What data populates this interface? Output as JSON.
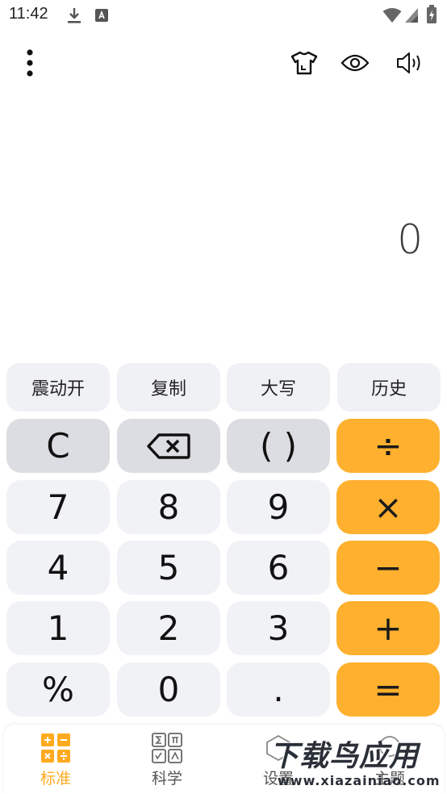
{
  "status_bar": {
    "time": "11:42"
  },
  "display": {
    "value": "0"
  },
  "function_row": [
    {
      "label": "震动开"
    },
    {
      "label": "复制"
    },
    {
      "label": "大写"
    },
    {
      "label": "历史"
    }
  ],
  "keypad": {
    "row1": [
      "C",
      "⌫",
      "( )",
      "÷"
    ],
    "row2": [
      "7",
      "8",
      "9",
      "×"
    ],
    "row3": [
      "4",
      "5",
      "6",
      "−"
    ],
    "row4": [
      "1",
      "2",
      "3",
      "+"
    ],
    "row5": [
      "%",
      "0",
      ".",
      "="
    ]
  },
  "tabs": [
    {
      "label": "标准",
      "active": true
    },
    {
      "label": "科学",
      "active": false
    },
    {
      "label": "设置",
      "active": false
    },
    {
      "label": "主题",
      "active": false
    }
  ],
  "watermark": {
    "title": "下载鸟应用",
    "url": "www.xiazainiao.com"
  },
  "colors": {
    "accent": "#ffb02e",
    "key_light": "#f1f2f6",
    "key_gray": "#dcdde2"
  }
}
